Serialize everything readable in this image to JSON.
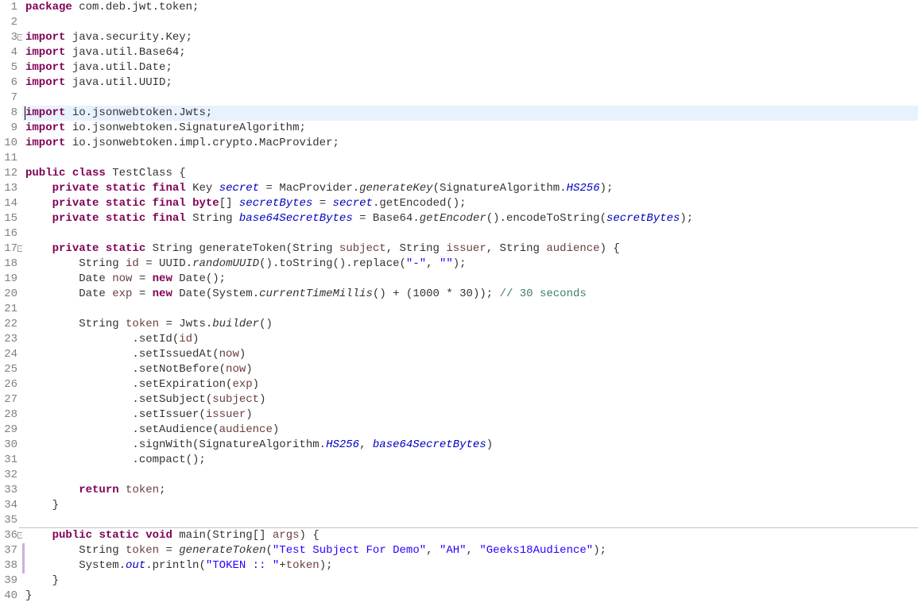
{
  "lines": [
    {
      "n": 1,
      "fold": false
    },
    {
      "n": 2,
      "fold": false
    },
    {
      "n": 3,
      "fold": true
    },
    {
      "n": 4,
      "fold": false
    },
    {
      "n": 5,
      "fold": false
    },
    {
      "n": 6,
      "fold": false
    },
    {
      "n": 7,
      "fold": false
    },
    {
      "n": 8,
      "fold": false,
      "hl": true,
      "cursor": true
    },
    {
      "n": 9,
      "fold": false
    },
    {
      "n": 10,
      "fold": false
    },
    {
      "n": 11,
      "fold": false
    },
    {
      "n": 12,
      "fold": false
    },
    {
      "n": 13,
      "fold": false
    },
    {
      "n": 14,
      "fold": false
    },
    {
      "n": 15,
      "fold": false
    },
    {
      "n": 16,
      "fold": false
    },
    {
      "n": 17,
      "fold": true
    },
    {
      "n": 18,
      "fold": false
    },
    {
      "n": 19,
      "fold": false
    },
    {
      "n": 20,
      "fold": false
    },
    {
      "n": 21,
      "fold": false
    },
    {
      "n": 22,
      "fold": false
    },
    {
      "n": 23,
      "fold": false
    },
    {
      "n": 24,
      "fold": false
    },
    {
      "n": 25,
      "fold": false
    },
    {
      "n": 26,
      "fold": false
    },
    {
      "n": 27,
      "fold": false
    },
    {
      "n": 28,
      "fold": false
    },
    {
      "n": 29,
      "fold": false
    },
    {
      "n": 30,
      "fold": false
    },
    {
      "n": 31,
      "fold": false
    },
    {
      "n": 32,
      "fold": false
    },
    {
      "n": 33,
      "fold": false
    },
    {
      "n": 34,
      "fold": false
    },
    {
      "n": 35,
      "fold": false,
      "bp": true
    },
    {
      "n": 36,
      "fold": true
    },
    {
      "n": 37,
      "fold": false,
      "mod": true
    },
    {
      "n": 38,
      "fold": false,
      "mod": true
    },
    {
      "n": 39,
      "fold": false
    },
    {
      "n": 40,
      "fold": false
    }
  ],
  "code": {
    "l1": {
      "kw1": "package",
      "t": " com.deb.jwt.token;"
    },
    "l3": {
      "kw1": "import",
      "t": " java.security.Key;"
    },
    "l4": {
      "kw1": "import",
      "t": " java.util.Base64;"
    },
    "l5": {
      "kw1": "import",
      "t": " java.util.Date;"
    },
    "l6": {
      "kw1": "import",
      "t": " java.util.UUID;"
    },
    "l8": {
      "kw1": "import",
      "t": " io.jsonwebtoken.Jwts;"
    },
    "l9": {
      "kw1": "import",
      "t": " io.jsonwebtoken.SignatureAlgorithm;"
    },
    "l10": {
      "kw1": "import",
      "t": " io.jsonwebtoken.impl.crypto.MacProvider;"
    },
    "l12": {
      "kw1": "public",
      "kw2": "class",
      "t": " TestClass {"
    },
    "l13": {
      "kw1": "private",
      "kw2": "static",
      "kw3": "final",
      "t1": " Key ",
      "fld": "secret",
      "t2": " = MacProvider.",
      "ital": "generateKey",
      "t3": "(SignatureAlgorithm.",
      "en": "HS256",
      "t4": ");"
    },
    "l14": {
      "kw1": "private",
      "kw2": "static",
      "kw3": "final",
      "kw4": "byte",
      "t1": "[] ",
      "fld": "secretBytes",
      "t2": " = ",
      "fld2": "secret",
      "t3": ".getEncoded();"
    },
    "l15": {
      "kw1": "private",
      "kw2": "static",
      "kw3": "final",
      "t1": " String ",
      "fld": "base64SecretBytes",
      "t2": " = Base64.",
      "ital": "getEncoder",
      "t3": "().encodeToString(",
      "fld2": "secretBytes",
      "t4": ");"
    },
    "l17": {
      "kw1": "private",
      "kw2": "static",
      "t1": " String generateToken(String ",
      "p1": "subject",
      "t2": ", String ",
      "p2": "issuer",
      "t3": ", String ",
      "p3": "audience",
      "t4": ") {"
    },
    "l18": {
      "t1": "        String ",
      "v": "id",
      "t2": " = UUID.",
      "ital": "randomUUID",
      "t3": "().toString().replace(",
      "s1": "\"-\"",
      "t4": ", ",
      "s2": "\"\"",
      "t5": ");"
    },
    "l19": {
      "t1": "        Date ",
      "v": "now",
      "t2": " = ",
      "kw": "new",
      "t3": " Date();"
    },
    "l20": {
      "t1": "        Date ",
      "v": "exp",
      "t2": " = ",
      "kw": "new",
      "t3": " Date(System.",
      "ital": "currentTimeMillis",
      "t4": "() + (1000 * 30)); ",
      "cmt": "// 30 seconds"
    },
    "l22": {
      "t1": "        String ",
      "v": "token",
      "t2": " = Jwts.",
      "ital": "builder",
      "t3": "()"
    },
    "l23": {
      "t1": "                .setId(",
      "v": "id",
      "t2": ")"
    },
    "l24": {
      "t1": "                .setIssuedAt(",
      "v": "now",
      "t2": ")"
    },
    "l25": {
      "t1": "                .setNotBefore(",
      "v": "now",
      "t2": ")"
    },
    "l26": {
      "t1": "                .setExpiration(",
      "v": "exp",
      "t2": ")"
    },
    "l27": {
      "t1": "                .setSubject(",
      "v": "subject",
      "t2": ")"
    },
    "l28": {
      "t1": "                .setIssuer(",
      "v": "issuer",
      "t2": ")"
    },
    "l29": {
      "t1": "                .setAudience(",
      "v": "audience",
      "t2": ")"
    },
    "l30": {
      "t1": "                .signWith(SignatureAlgorithm.",
      "en": "HS256",
      "t2": ", ",
      "fld": "base64SecretBytes",
      "t3": ")"
    },
    "l31": {
      "t1": "                .compact();"
    },
    "l33": {
      "kw": "return",
      "t1": " ",
      "v": "token",
      "t2": ";"
    },
    "l34": {
      "t": "    }"
    },
    "l36": {
      "kw1": "public",
      "kw2": "static",
      "kw3": "void",
      "t1": " main(String[] ",
      "p": "args",
      "t2": ") {"
    },
    "l37": {
      "t1": "        String ",
      "v": "token",
      "t2": " = ",
      "ital": "generateToken",
      "t3": "(",
      "s1": "\"Test Subject For Demo\"",
      "t4": ", ",
      "s2": "\"AH\"",
      "t5": ", ",
      "s3": "\"Geeks18Audience\"",
      "t6": ");"
    },
    "l38": {
      "t1": "        System.",
      "fld": "out",
      "t2": ".println(",
      "s1": "\"TOKEN :: \"",
      "t3": "+",
      "v": "token",
      "t4": ");"
    },
    "l39": {
      "t": "    }"
    },
    "l40": {
      "t": "}"
    }
  }
}
